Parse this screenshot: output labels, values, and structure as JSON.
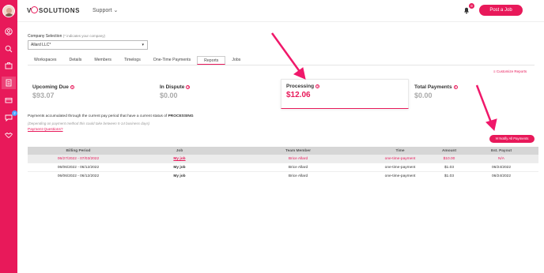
{
  "brand": {
    "logo_prefix": "V",
    "logo_suffix": "SOLUTIONS",
    "accent": "#e8195a"
  },
  "header": {
    "support_label": "Support",
    "notifications_count": "8",
    "post_job_label": "Post a Job"
  },
  "sidebar": {
    "messages_badge": "2"
  },
  "company": {
    "label": "Company Selection",
    "hint": "(* indicates your company)",
    "selected": "Allard LLC*"
  },
  "tabs": [
    "Workspaces",
    "Details",
    "Members",
    "Timelogs",
    "One-Time Payments",
    "Reports",
    "Jobs"
  ],
  "customize_reports": "Customize Reports",
  "cards": [
    {
      "title": "Upcoming Due",
      "value": "$93.07"
    },
    {
      "title": "In Dispute",
      "value": "$0.00"
    },
    {
      "title": "Processing",
      "value": "$12.06"
    },
    {
      "title": "Total Payments",
      "value": "$0.00"
    }
  ],
  "info": {
    "accumulated_prefix": "Payments accumulated through the current pay period that have a current status of ",
    "accumulated_status": "PROCESSING",
    "depending": "(Depending on payment method this could take between 5-14 business days)",
    "questions": "Payment Questions?"
  },
  "notify_label": "Notify All Payments",
  "table": {
    "headers": [
      "Billing Period",
      "Job",
      "Team Member",
      "Time",
      "Amount",
      "Est. Payout"
    ],
    "rows": [
      [
        "06/27/2022 - 07/03/2022",
        "My job",
        "Brice Allard",
        "one-time-payment",
        "$10.00",
        "N/A"
      ],
      [
        "06/06/2022 - 06/12/2022",
        "My job",
        "Brice Allard",
        "one-time-payment",
        "$1.03",
        "06/24/2022"
      ],
      [
        "06/06/2022 - 06/12/2022",
        "My job",
        "Brice Allard",
        "one-time-payment",
        "$1.03",
        "06/24/2022"
      ]
    ]
  }
}
